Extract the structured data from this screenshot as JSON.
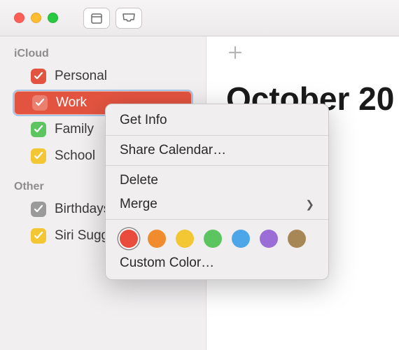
{
  "sidebar": {
    "sections": [
      {
        "label": "iCloud",
        "items": [
          {
            "name": "Personal",
            "color": "#e35440",
            "selected": false
          },
          {
            "name": "Work",
            "color": "#e35440",
            "selected": true
          },
          {
            "name": "Family",
            "color": "#5dc560",
            "selected": false
          },
          {
            "name": "School",
            "color": "#f2c733",
            "selected": false
          }
        ]
      },
      {
        "label": "Other",
        "items": [
          {
            "name": "Birthdays",
            "color": "#9b9a9b",
            "selected": false
          },
          {
            "name": "Siri Suggestions",
            "color": "#f2c733",
            "selected": false
          }
        ]
      }
    ]
  },
  "main": {
    "title": "October 20"
  },
  "context_menu": {
    "items": {
      "get_info": "Get Info",
      "share": "Share Calendar…",
      "delete": "Delete",
      "merge": "Merge",
      "custom_color": "Custom Color…"
    },
    "colors": [
      "#e94b3c",
      "#f08c2e",
      "#f2c733",
      "#5dc560",
      "#4da6e8",
      "#9a6dd7",
      "#a88757"
    ],
    "selected_color_index": 0
  }
}
